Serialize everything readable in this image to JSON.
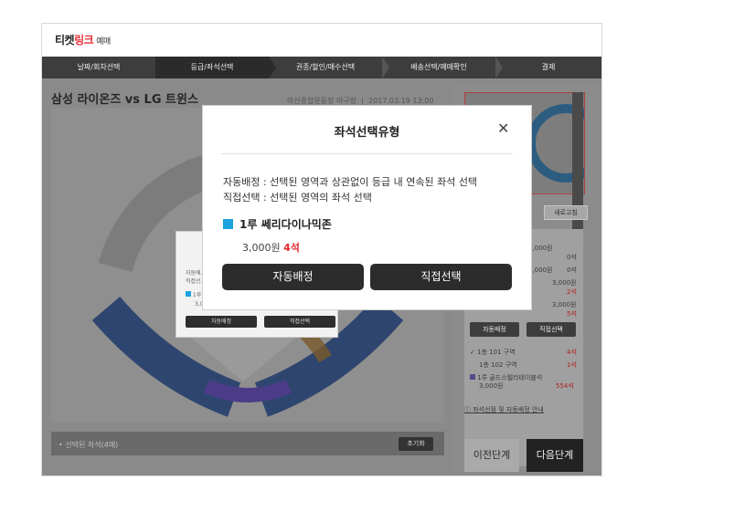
{
  "brand": {
    "part1": "티켓",
    "part2": "링크",
    "part3": "예매"
  },
  "steps": [
    "날짜/회차선택",
    "등급/좌석선택",
    "권종/할인/매수선택",
    "배송선택/예매확인",
    "결제"
  ],
  "match": {
    "title": "삼성 라이온즈 vs LG 트윈스",
    "venue": "마산종합운동장 야구장",
    "datetime": "2017.03.19 13:00"
  },
  "bottom": {
    "selected_label": "선택된 좌석(4매)",
    "reset": "초기화"
  },
  "side": {
    "refresh": "새로고침",
    "grades": [
      {
        "name": "…석",
        "price": "3,000원",
        "count": "0석"
      },
      {
        "name": "",
        "price": "3,000원",
        "count": "0석"
      },
      {
        "name": "…",
        "price": "3,000원",
        "count": "2석"
      },
      {
        "name": "…존",
        "price": "3,000원",
        "count": "5석"
      }
    ],
    "auto_btn": "자동배정",
    "direct_btn": "직접선택",
    "zones": [
      {
        "name": "1층 101 구역",
        "count": "4석"
      },
      {
        "name": "1층 102 구역",
        "count": "1석"
      }
    ],
    "extra": {
      "name": "1루 골드스텔라테이블석",
      "price": "3,000원",
      "count": "554석"
    },
    "guide": "좌석선점 및 자동배정 안내",
    "prev": "이전단계",
    "next": "다음단계"
  },
  "dialog": {
    "title": "좌석선택유형",
    "desc1": "자동배정 : 선택된 영역과 상관없이 등급 내 연속된 좌석 선택",
    "desc2": "직접선택 : 선택된 영역의 좌석 선택",
    "grade": "1루 쎄리다이나믹존",
    "price": "3,000원",
    "count": "4석",
    "auto": "자동배정",
    "direct": "직접선택"
  },
  "colors": {
    "accent_red": "#e3262e",
    "grade_blue": "#1aa3dc"
  }
}
